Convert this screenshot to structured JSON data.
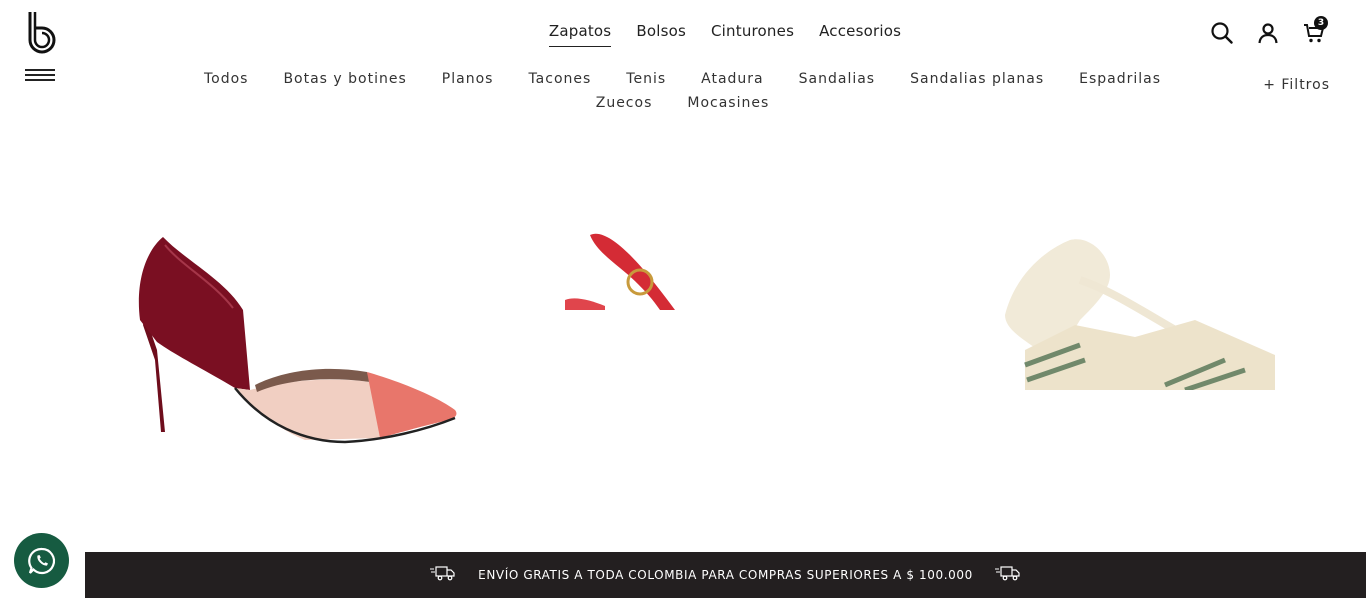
{
  "brand": {
    "logo_icon": "brand-b-logo"
  },
  "top_nav": {
    "items": [
      {
        "label": "Zapatos",
        "active": true
      },
      {
        "label": "Bolsos",
        "active": false
      },
      {
        "label": "Cinturones",
        "active": false
      },
      {
        "label": "Accesorios",
        "active": false
      }
    ]
  },
  "header_icons": {
    "search": "search-icon",
    "account": "user-icon",
    "cart": "cart-icon",
    "cart_count": "3"
  },
  "category_nav": {
    "items": [
      "Todos",
      "Botas y botines",
      "Planos",
      "Tacones",
      "Tenis",
      "Atadura",
      "Sandalias",
      "Sandalias planas",
      "Espadrilas",
      "Zuecos",
      "Mocasines"
    ],
    "filters_label": "+ Filtros"
  },
  "products": [
    {
      "image": "burgundy-pink-pointed-heel"
    },
    {
      "image": "red-strap-sandal-cropped"
    },
    {
      "image": "cream-striped-lace-up-espadrille"
    }
  ],
  "promo": {
    "text": "ENVÍO GRATIS A TODA COLOMBIA PARA COMPRAS SUPERIORES A $ 100.000",
    "icon": "delivery-truck-icon"
  },
  "whatsapp": {
    "icon": "whatsapp-icon",
    "color": "#165b41"
  },
  "colors": {
    "promo_bg": "#231f20",
    "text": "#222222"
  }
}
